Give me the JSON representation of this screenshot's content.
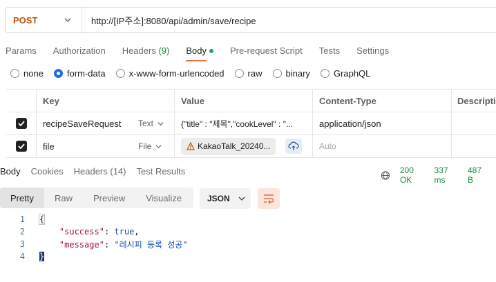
{
  "request": {
    "method": "POST",
    "url": "http://[IP주소]:8080/api/admin/save/recipe"
  },
  "request_tabs": [
    {
      "label": "Params"
    },
    {
      "label": "Authorization"
    },
    {
      "label": "Headers",
      "count": "(9)"
    },
    {
      "label": "Body"
    },
    {
      "label": "Pre-request Script"
    },
    {
      "label": "Tests"
    },
    {
      "label": "Settings"
    }
  ],
  "body_types": [
    "none",
    "form-data",
    "x-www-form-urlencoded",
    "raw",
    "binary",
    "GraphQL"
  ],
  "selected_body_type": "form-data",
  "form_table": {
    "headers": [
      "Key",
      "Value",
      "Content-Type",
      "Descriptio"
    ],
    "rows": [
      {
        "key": "recipeSaveRequest",
        "type": "Text",
        "value": "{\"title\" : \"제목\",\"cookLevel\" : \"...",
        "value_more": "...",
        "content_type": "application/json"
      },
      {
        "key": "file",
        "type": "File",
        "value": "KakaoTalk_20240...",
        "content_type_placeholder": "Auto"
      }
    ]
  },
  "response_tabs": [
    {
      "label": "Body"
    },
    {
      "label": "Cookies"
    },
    {
      "label": "Headers (14)"
    },
    {
      "label": "Test Results"
    }
  ],
  "response_status": {
    "status": "200 OK",
    "time": "337 ms",
    "size": "487 B"
  },
  "response_views": [
    "Pretty",
    "Raw",
    "Preview",
    "Visualize"
  ],
  "response_format": "JSON",
  "code_lines": {
    "n1": "1",
    "n2": "2",
    "n3": "3",
    "n4": "4",
    "open": "{",
    "k1": "\"success\"",
    "colon": ": ",
    "v1": "true",
    "comma": ",",
    "k2": "\"message\"",
    "v2": "\"레시피 등록 성공\"",
    "close": "}"
  },
  "colors": {
    "method": "#c2560e",
    "accent": "#f26b3a",
    "status_ok": "#1e8a3c",
    "radio_selected": "#1a6ee6"
  }
}
